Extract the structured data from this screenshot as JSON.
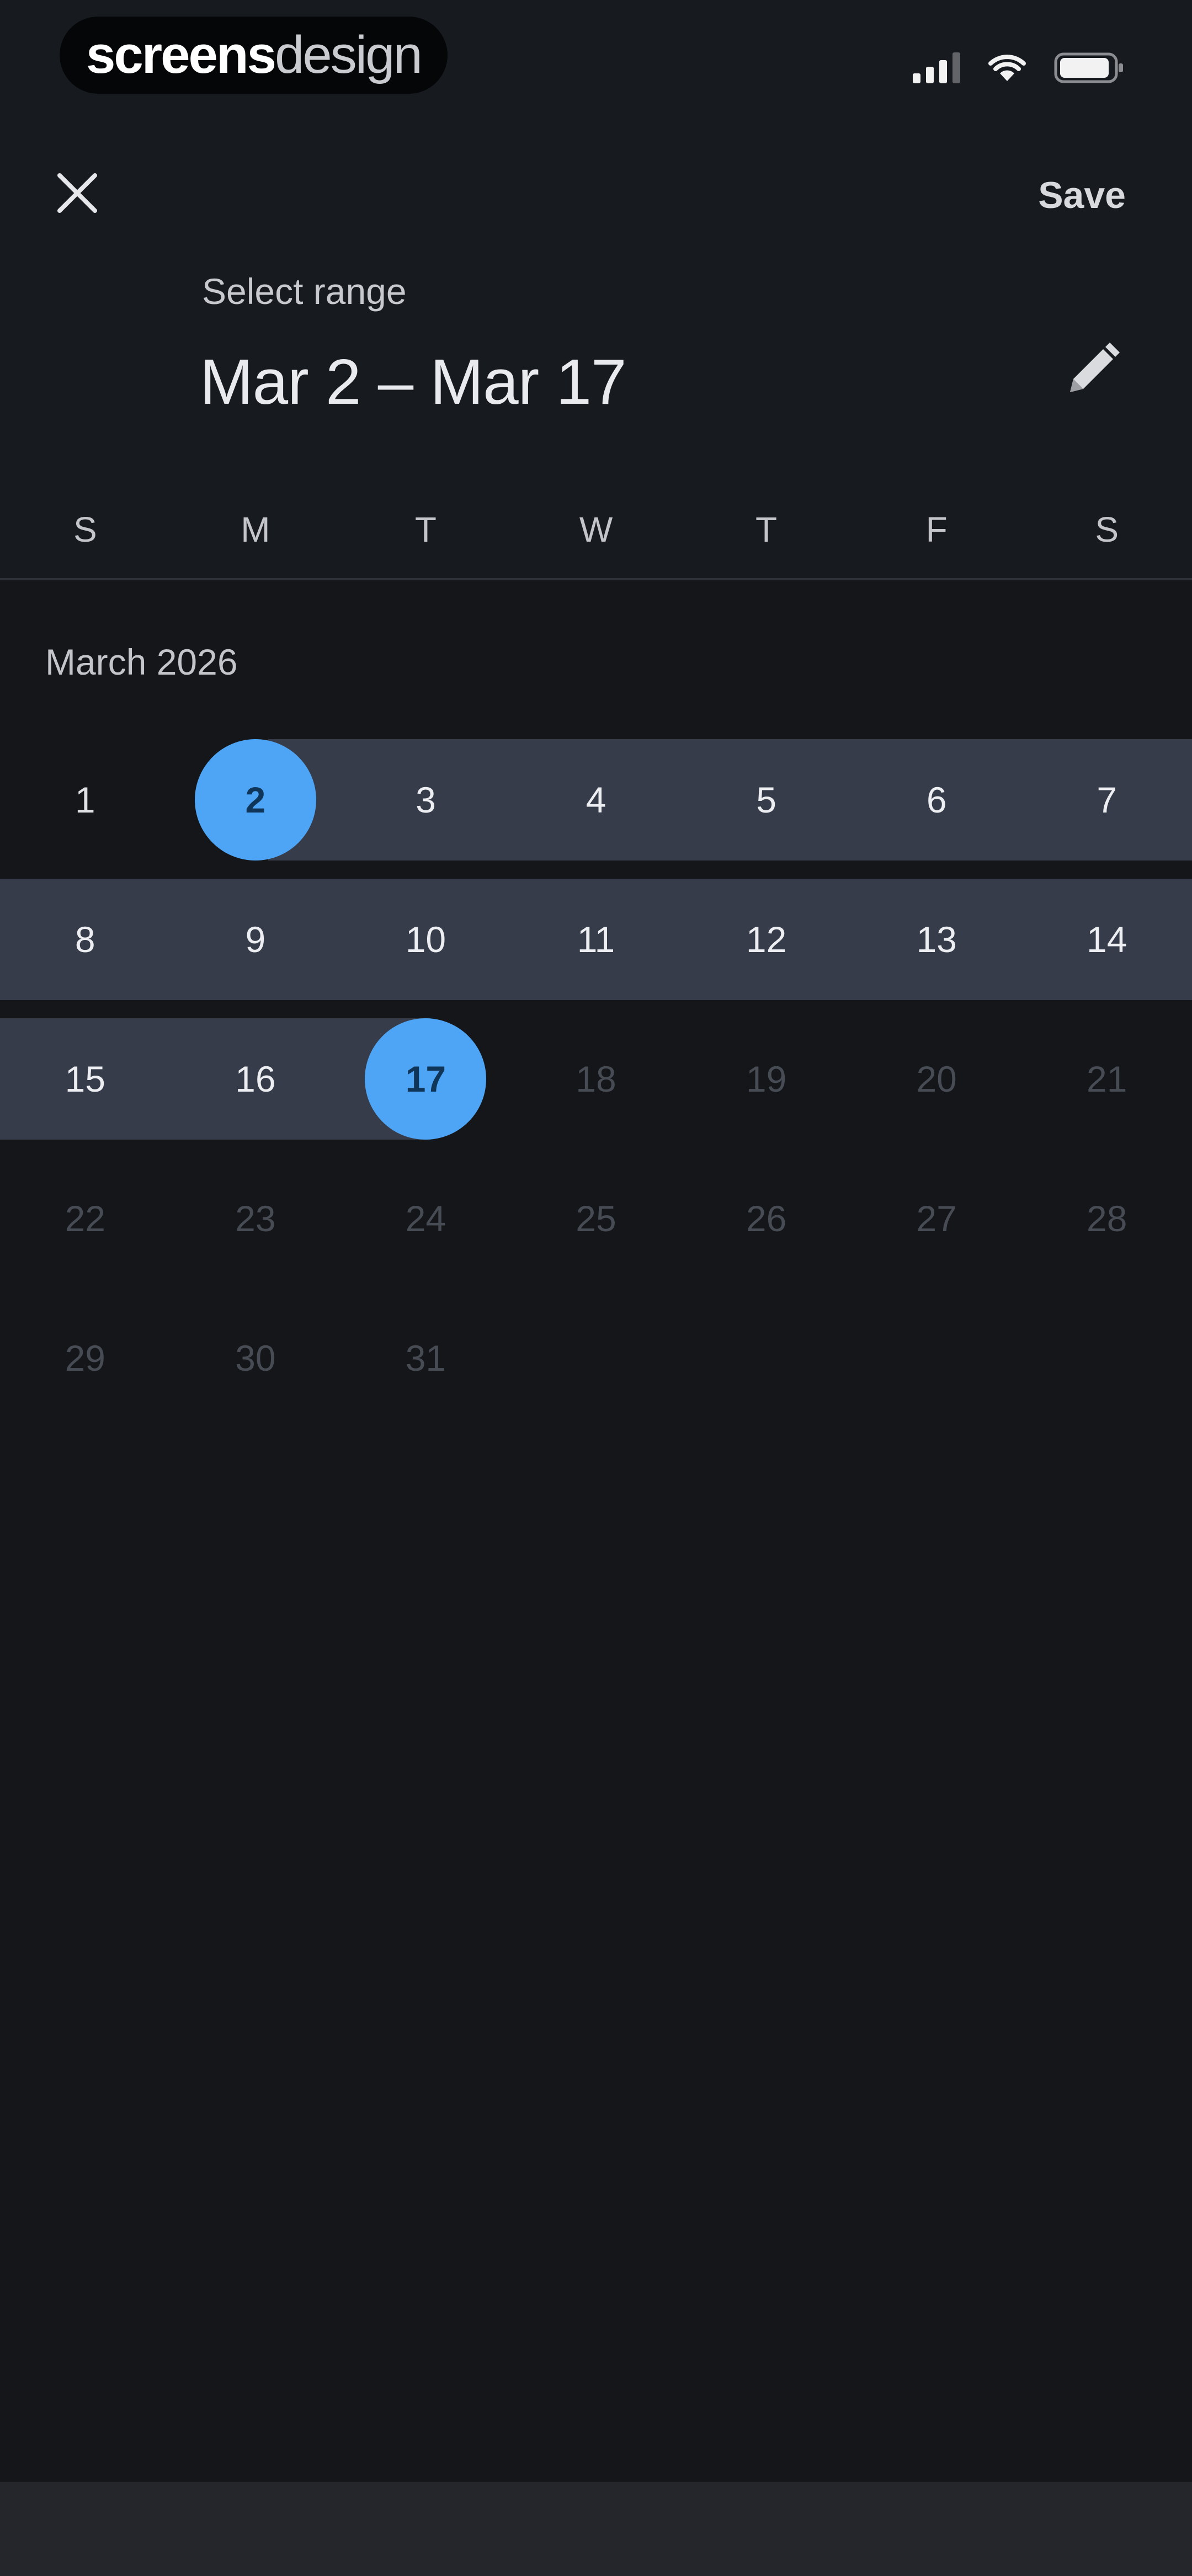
{
  "status_bar": {
    "brand_strong": "screens",
    "brand_light": "design",
    "icons": [
      "signal-icon",
      "wifi-icon",
      "battery-icon"
    ]
  },
  "header": {
    "close_icon": "close-icon",
    "save_label": "Save",
    "caption": "Select range",
    "range": "Mar 2 – Mar 17",
    "edit_icon": "pencil-icon"
  },
  "weekdays": [
    "S",
    "M",
    "T",
    "W",
    "T",
    "F",
    "S"
  ],
  "calendar": {
    "month": "March 2026",
    "selected_start": 2,
    "selected_end": 17,
    "weeks": [
      [
        "1",
        "2",
        "3",
        "4",
        "5",
        "6",
        "7"
      ],
      [
        "8",
        "9",
        "10",
        "11",
        "12",
        "13",
        "14"
      ],
      [
        "15",
        "16",
        "17",
        "18",
        "19",
        "20",
        "21"
      ],
      [
        "22",
        "23",
        "24",
        "25",
        "26",
        "27",
        "28"
      ],
      [
        "29",
        "30",
        "31",
        "",
        "",
        "",
        ""
      ]
    ]
  },
  "colors": {
    "background": "#14161a",
    "accent": "#4ea5f5",
    "range_band": "#363c4a"
  }
}
